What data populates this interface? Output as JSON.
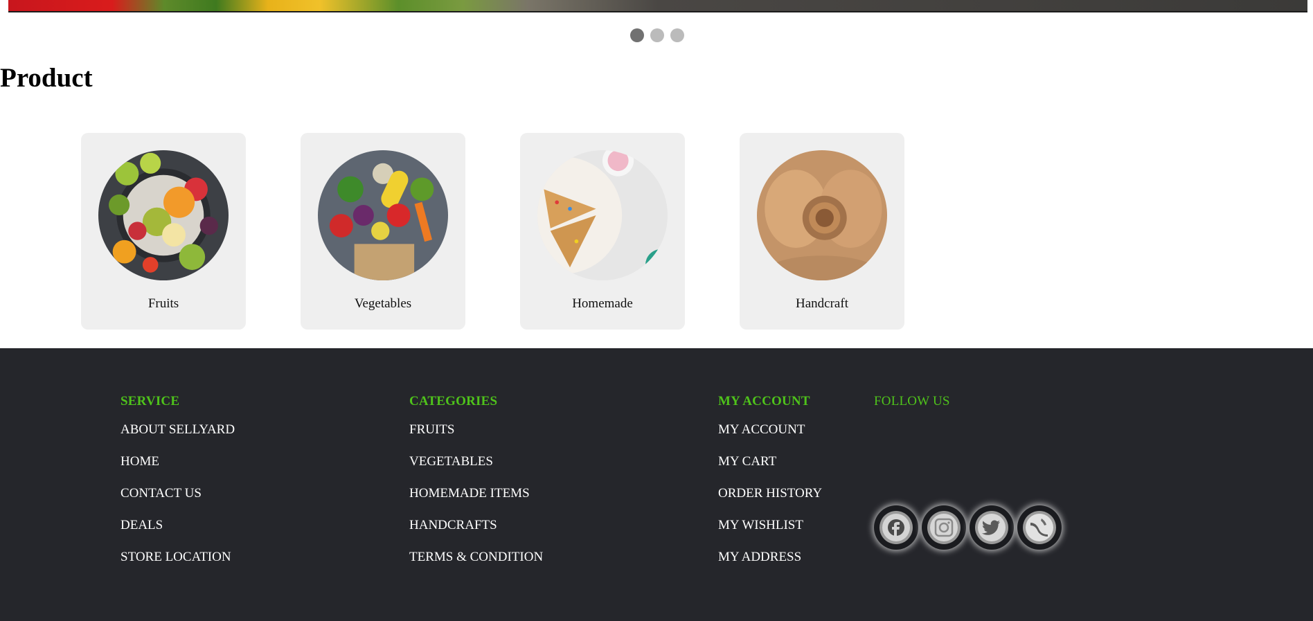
{
  "carousel": {
    "slide_count": 3,
    "active_index": 0
  },
  "section": {
    "title": "Product"
  },
  "products": [
    {
      "label": "Fruits",
      "icon": "fruits-image"
    },
    {
      "label": "Vegetables",
      "icon": "vegetables-image"
    },
    {
      "label": "Homemade",
      "icon": "homemade-image"
    },
    {
      "label": "Handcraft",
      "icon": "handcraft-image"
    }
  ],
  "footer": {
    "service": {
      "heading": "SERVICE",
      "links": [
        "ABOUT SELLYARD",
        "HOME",
        "CONTACT US",
        "DEALS",
        "STORE LOCATION"
      ]
    },
    "categories": {
      "heading": "CATEGORIES",
      "links": [
        "FRUITS",
        "VEGETABLES",
        "HOMEMADE ITEMS",
        "HANDCRAFTS",
        "TERMS & CONDITION"
      ]
    },
    "account": {
      "heading": "MY ACCOUNT",
      "links": [
        "MY ACCOUNT",
        "MY CART",
        "ORDER HISTORY",
        "MY WISHLIST",
        "MY ADDRESS"
      ]
    },
    "follow": {
      "heading": "FOLLOW US",
      "icons": [
        "facebook-icon",
        "instagram-icon",
        "twitter-icon",
        "skype-icon"
      ]
    }
  },
  "colors": {
    "accent": "#4fc31b",
    "footer_bg": "#25262b",
    "card_bg": "#efefef"
  }
}
